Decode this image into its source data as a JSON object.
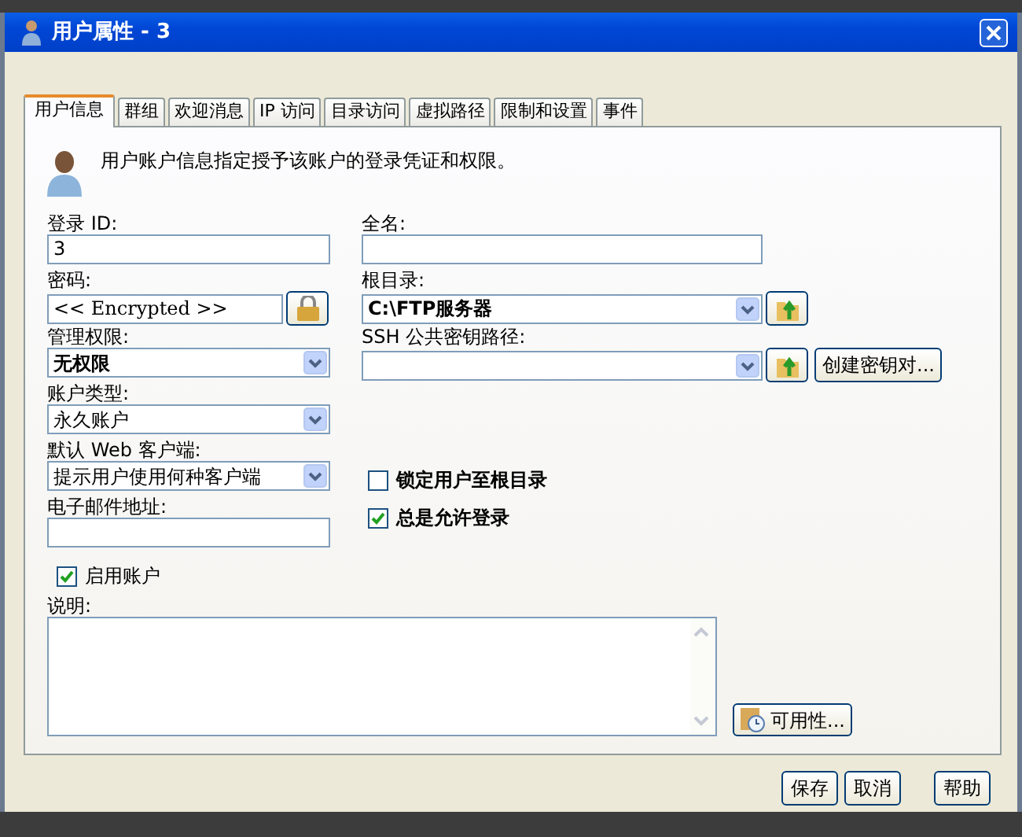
{
  "window": {
    "title": "用户属性 - 3"
  },
  "tabs": [
    {
      "label": "用户信息",
      "selected": true
    },
    {
      "label": "群组",
      "selected": false
    },
    {
      "label": "欢迎消息",
      "selected": false
    },
    {
      "label": "IP 访问",
      "selected": false
    },
    {
      "label": "目录访问",
      "selected": false
    },
    {
      "label": "虚拟路径",
      "selected": false
    },
    {
      "label": "限制和设置",
      "selected": false
    },
    {
      "label": "事件",
      "selected": false
    }
  ],
  "info_text": "用户账户信息指定授予该账户的登录凭证和权限。",
  "left_fields": [
    {
      "kind": "text",
      "label": "登录 ID:",
      "value": "3"
    },
    {
      "kind": "password",
      "label": "密码:",
      "value": "<< Encrypted >>"
    },
    {
      "kind": "select",
      "label": "管理权限:",
      "value": "无权限",
      "bold": true
    },
    {
      "kind": "select",
      "label": "账户类型:",
      "value": "永久账户",
      "bold": false
    },
    {
      "kind": "select",
      "label": "默认 Web 客户端:",
      "value": "提示用户使用何种客户端",
      "bold": false
    },
    {
      "kind": "text",
      "label": "电子邮件地址:"
    }
  ],
  "right_fields": [
    {
      "kind": "text",
      "label": "全名:"
    },
    {
      "kind": "folder-select",
      "label": "根目录:",
      "value": "C:\\FTP服务器",
      "bold": true
    },
    {
      "kind": "folder-select",
      "label": "SSH 公共密钥路径:",
      "extra_button": "创建密钥对..."
    }
  ],
  "right_checkboxes": [
    {
      "label": "锁定用户至根目录",
      "checked": false
    },
    {
      "label": "总是允许登录",
      "checked": true
    }
  ],
  "enable_checkbox": {
    "label": "启用账户",
    "checked": true
  },
  "description": {
    "label": "说明:"
  },
  "availability_button": "可用性...",
  "footer_buttons": [
    "保存",
    "取消",
    "帮助"
  ]
}
